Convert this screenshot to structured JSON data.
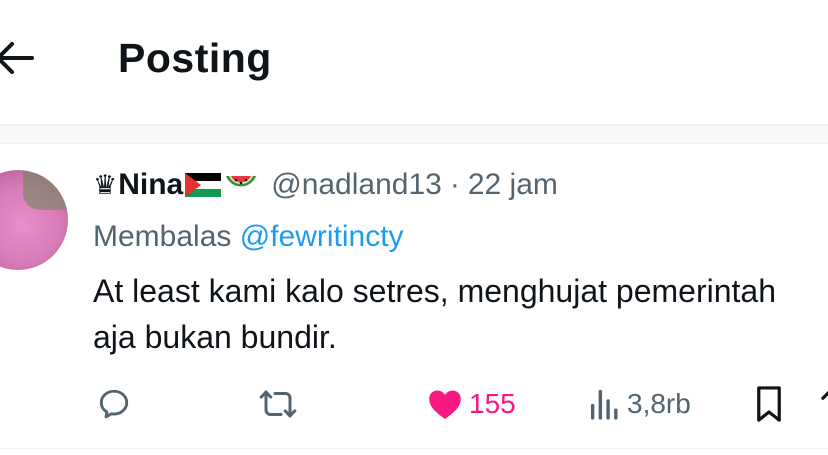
{
  "header": {
    "title": "Posting",
    "back_icon": "arrow-left-icon"
  },
  "tweet": {
    "author": {
      "crown_emoji": "♛",
      "display_name": "Nina",
      "flag_emoji": "palestine-flag",
      "melon_emoji": "watermelon",
      "handle": "@nadland13"
    },
    "separator": "·",
    "time": "22 jam",
    "reply_prefix": "Membalas",
    "reply_to": "@fewritincty",
    "text_line1": "At least kami kalo setres, menghujat pemerintah",
    "text_line2": "aja bukan bundir."
  },
  "actions": {
    "reply": {
      "icon": "reply-icon"
    },
    "retweet": {
      "icon": "retweet-icon"
    },
    "like": {
      "icon": "heart-icon",
      "count": "155",
      "color": "#f91880"
    },
    "views": {
      "icon": "views-icon",
      "count": "3,8rb"
    },
    "bookmark": {
      "icon": "bookmark-icon"
    },
    "share": {
      "icon": "share-icon"
    }
  },
  "colors": {
    "accent": "#1d9bf0",
    "muted": "#536471",
    "text": "#0f1419",
    "like": "#f91880"
  }
}
